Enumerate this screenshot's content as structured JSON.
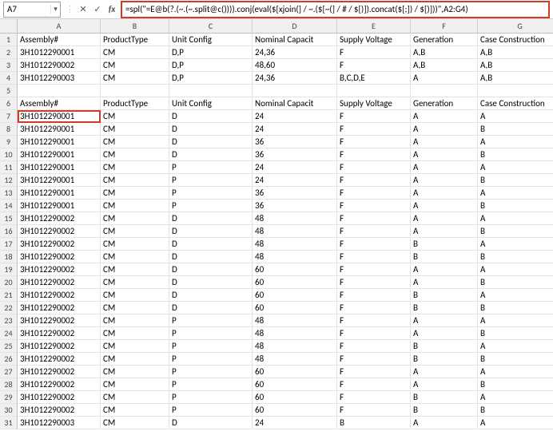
{
  "name_box": "A7",
  "formula": "=spl(\"=E@b(?.(~.(~.split@c()))).conj(eval($[xjoin(] / ~.($[~(] / # / $[)]).concat($[;]) / $[)]))\",A2:G4)",
  "columns": [
    "A",
    "B",
    "C",
    "D",
    "E",
    "F",
    "G"
  ],
  "headers1": [
    "Assembly#",
    "ProductType",
    "Unit Config",
    "Nominal Capacit",
    "Supply Voltage",
    "Generation",
    "Case Construction"
  ],
  "source_rows": [
    [
      "3H1012290001",
      "CM",
      "D,P",
      "24,36",
      "F",
      "A,B",
      "A,B"
    ],
    [
      "3H1012290002",
      "CM",
      "D,P",
      "48,60",
      "F",
      "A,B",
      "A,B"
    ],
    [
      "3H1012290003",
      "CM",
      "D,P",
      "24,36",
      "B,C,D,E",
      "A",
      "A,B"
    ]
  ],
  "headers2": [
    "Assembly#",
    "ProductType",
    "Unit Config",
    "Nominal Capacit",
    "Supply Voltage",
    "Generation",
    "Case Construction"
  ],
  "chart_data": {
    "type": "table",
    "columns": [
      "Assembly#",
      "ProductType",
      "Unit Config",
      "Nominal Capacity",
      "Supply Voltage",
      "Generation",
      "Case Construction"
    ],
    "rows": [
      [
        "3H1012290001",
        "CM",
        "D",
        "24",
        "F",
        "A",
        "A"
      ],
      [
        "3H1012290001",
        "CM",
        "D",
        "24",
        "F",
        "A",
        "B"
      ],
      [
        "3H1012290001",
        "CM",
        "D",
        "36",
        "F",
        "A",
        "A"
      ],
      [
        "3H1012290001",
        "CM",
        "D",
        "36",
        "F",
        "A",
        "B"
      ],
      [
        "3H1012290001",
        "CM",
        "P",
        "24",
        "F",
        "A",
        "A"
      ],
      [
        "3H1012290001",
        "CM",
        "P",
        "24",
        "F",
        "A",
        "B"
      ],
      [
        "3H1012290001",
        "CM",
        "P",
        "36",
        "F",
        "A",
        "A"
      ],
      [
        "3H1012290001",
        "CM",
        "P",
        "36",
        "F",
        "A",
        "B"
      ],
      [
        "3H1012290002",
        "CM",
        "D",
        "48",
        "F",
        "A",
        "A"
      ],
      [
        "3H1012290002",
        "CM",
        "D",
        "48",
        "F",
        "A",
        "B"
      ],
      [
        "3H1012290002",
        "CM",
        "D",
        "48",
        "F",
        "B",
        "A"
      ],
      [
        "3H1012290002",
        "CM",
        "D",
        "48",
        "F",
        "B",
        "B"
      ],
      [
        "3H1012290002",
        "CM",
        "D",
        "60",
        "F",
        "A",
        "A"
      ],
      [
        "3H1012290002",
        "CM",
        "D",
        "60",
        "F",
        "A",
        "B"
      ],
      [
        "3H1012290002",
        "CM",
        "D",
        "60",
        "F",
        "B",
        "A"
      ],
      [
        "3H1012290002",
        "CM",
        "D",
        "60",
        "F",
        "B",
        "B"
      ],
      [
        "3H1012290002",
        "CM",
        "P",
        "48",
        "F",
        "A",
        "A"
      ],
      [
        "3H1012290002",
        "CM",
        "P",
        "48",
        "F",
        "A",
        "B"
      ],
      [
        "3H1012290002",
        "CM",
        "P",
        "48",
        "F",
        "B",
        "A"
      ],
      [
        "3H1012290002",
        "CM",
        "P",
        "48",
        "F",
        "B",
        "B"
      ],
      [
        "3H1012290002",
        "CM",
        "P",
        "60",
        "F",
        "A",
        "A"
      ],
      [
        "3H1012290002",
        "CM",
        "P",
        "60",
        "F",
        "A",
        "B"
      ],
      [
        "3H1012290002",
        "CM",
        "P",
        "60",
        "F",
        "B",
        "A"
      ],
      [
        "3H1012290002",
        "CM",
        "P",
        "60",
        "F",
        "B",
        "B"
      ],
      [
        "3H1012290003",
        "CM",
        "D",
        "24",
        "B",
        "A",
        "A"
      ]
    ]
  }
}
